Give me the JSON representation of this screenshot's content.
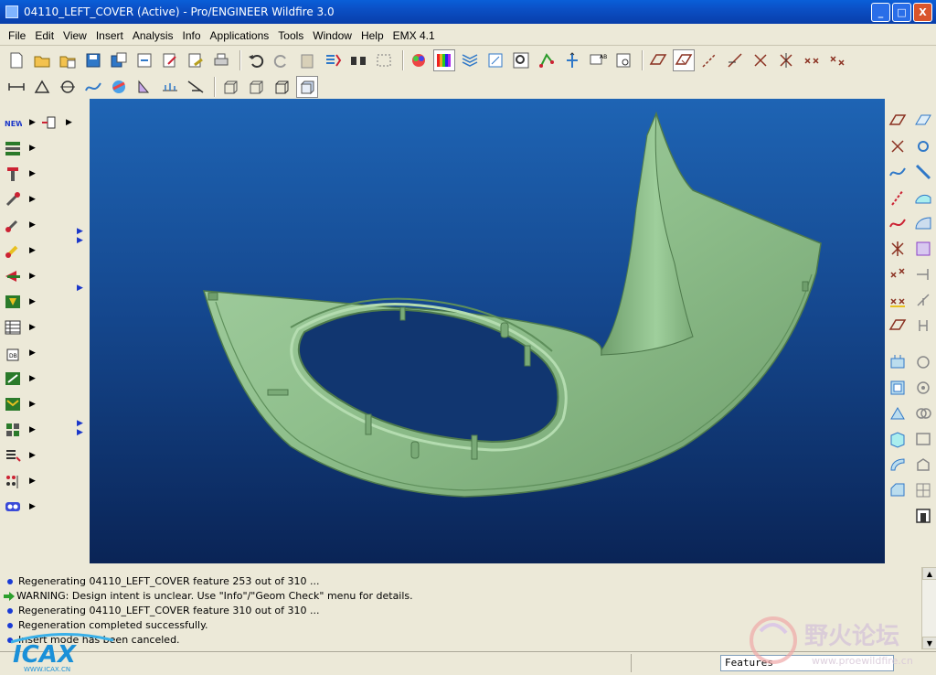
{
  "window": {
    "title": "04110_LEFT_COVER (Active) - Pro/ENGINEER Wildfire 3.0",
    "minimize": "_",
    "maximize": "□",
    "close": "X"
  },
  "menu": [
    "File",
    "Edit",
    "View",
    "Insert",
    "Analysis",
    "Info",
    "Applications",
    "Tools",
    "Window",
    "Help",
    "EMX 4.1"
  ],
  "toolbar": {
    "row1_icons": [
      "new-icon",
      "open-icon",
      "open-folder-icon",
      "save-icon",
      "save-copy-icon",
      "backup-icon",
      "rename-icon",
      "erase-icon",
      "print-icon",
      "undo-icon",
      "redo-icon",
      "paste-icon",
      "regenerate-icon",
      "find-icon",
      "select-box-icon",
      "appearance-icon",
      "color-editor-icon",
      "layers-icon",
      "model-tree-icon",
      "zoom-icon",
      "datum-icon",
      "view-icon",
      "saved-views-icon",
      "spin-center-icon"
    ],
    "row2_icons": [
      "measure-icon",
      "mass-icon",
      "section-icon",
      "curvature-icon",
      "draft-icon",
      "analysis-icon",
      "wireframe-icon",
      "hidden-line-icon",
      "no-hidden-icon",
      "shading-icon"
    ]
  },
  "messages": [
    {
      "type": "info",
      "text": "Regenerating 04110_LEFT_COVER feature 253 out of 310 ..."
    },
    {
      "type": "warning",
      "text": "WARNING: Design intent is unclear.  Use \"Info\"/\"Geom Check\" menu for details."
    },
    {
      "type": "info",
      "text": "Regenerating 04110_LEFT_COVER feature 310 out of 310 ..."
    },
    {
      "type": "info",
      "text": "Regeneration completed successfully."
    },
    {
      "type": "info",
      "text": "Insert mode has been canceled."
    }
  ],
  "status": {
    "filter_value": "Features"
  },
  "logos": {
    "left_text": "ICAX",
    "left_sub": "WWW.ICAX.CN",
    "right_text": "野火论坛",
    "right_sub": "www.proewildfire.cn"
  },
  "colors": {
    "model": "#8fbf8c",
    "viewport_top": "#1e64b4",
    "viewport_bottom": "#0a2456",
    "titlebar": "#0b4fc4"
  }
}
